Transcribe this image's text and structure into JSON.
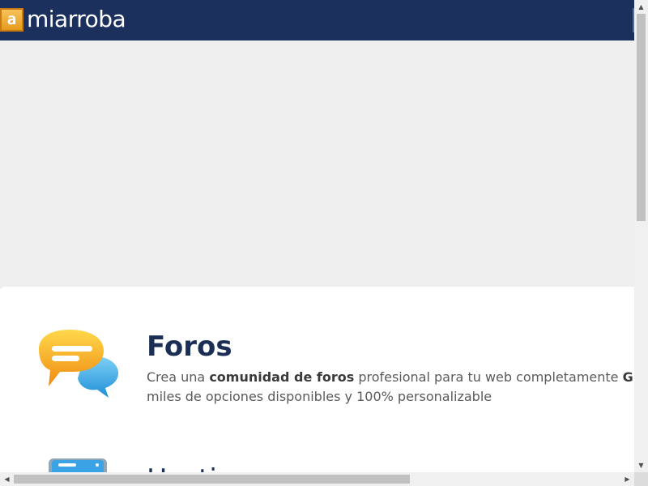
{
  "header": {
    "logo_mark": "a",
    "logo_text": "miarroba"
  },
  "sections": [
    {
      "icon": "chat-bubbles-icon",
      "title": "Foros",
      "desc_1": "Crea una ",
      "desc_bold_1": "comunidad de foros",
      "desc_2": " profesional para tu web completamente ",
      "desc_bold_2": "GRATIS",
      "desc_3": "miles de opciones disponibles y 100% personalizable"
    },
    {
      "icon": "server-icon",
      "title": "Hosting"
    }
  ],
  "scrollbars": {
    "up": "▲",
    "down": "▼",
    "left": "◀",
    "right": "▶"
  },
  "colors": {
    "header_bg": "#1b305c",
    "title": "#1b2f56",
    "logo_orange": "#e69a1d"
  }
}
